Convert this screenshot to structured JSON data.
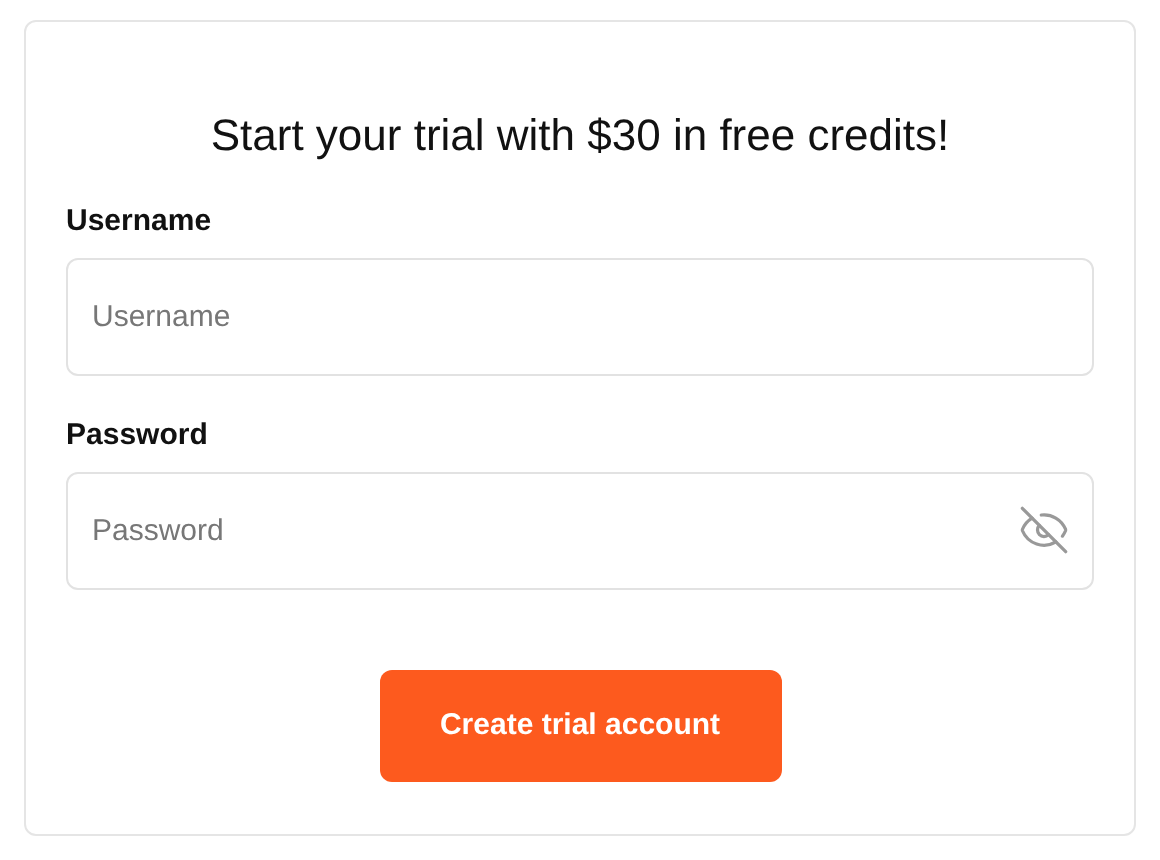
{
  "title": "Start your trial with $30 in free credits!",
  "fields": [
    {
      "label": "Username",
      "placeholder": "Username",
      "kind": "text"
    },
    {
      "label": "Password",
      "placeholder": "Password",
      "kind": "password"
    }
  ],
  "submit": "Create trial account"
}
